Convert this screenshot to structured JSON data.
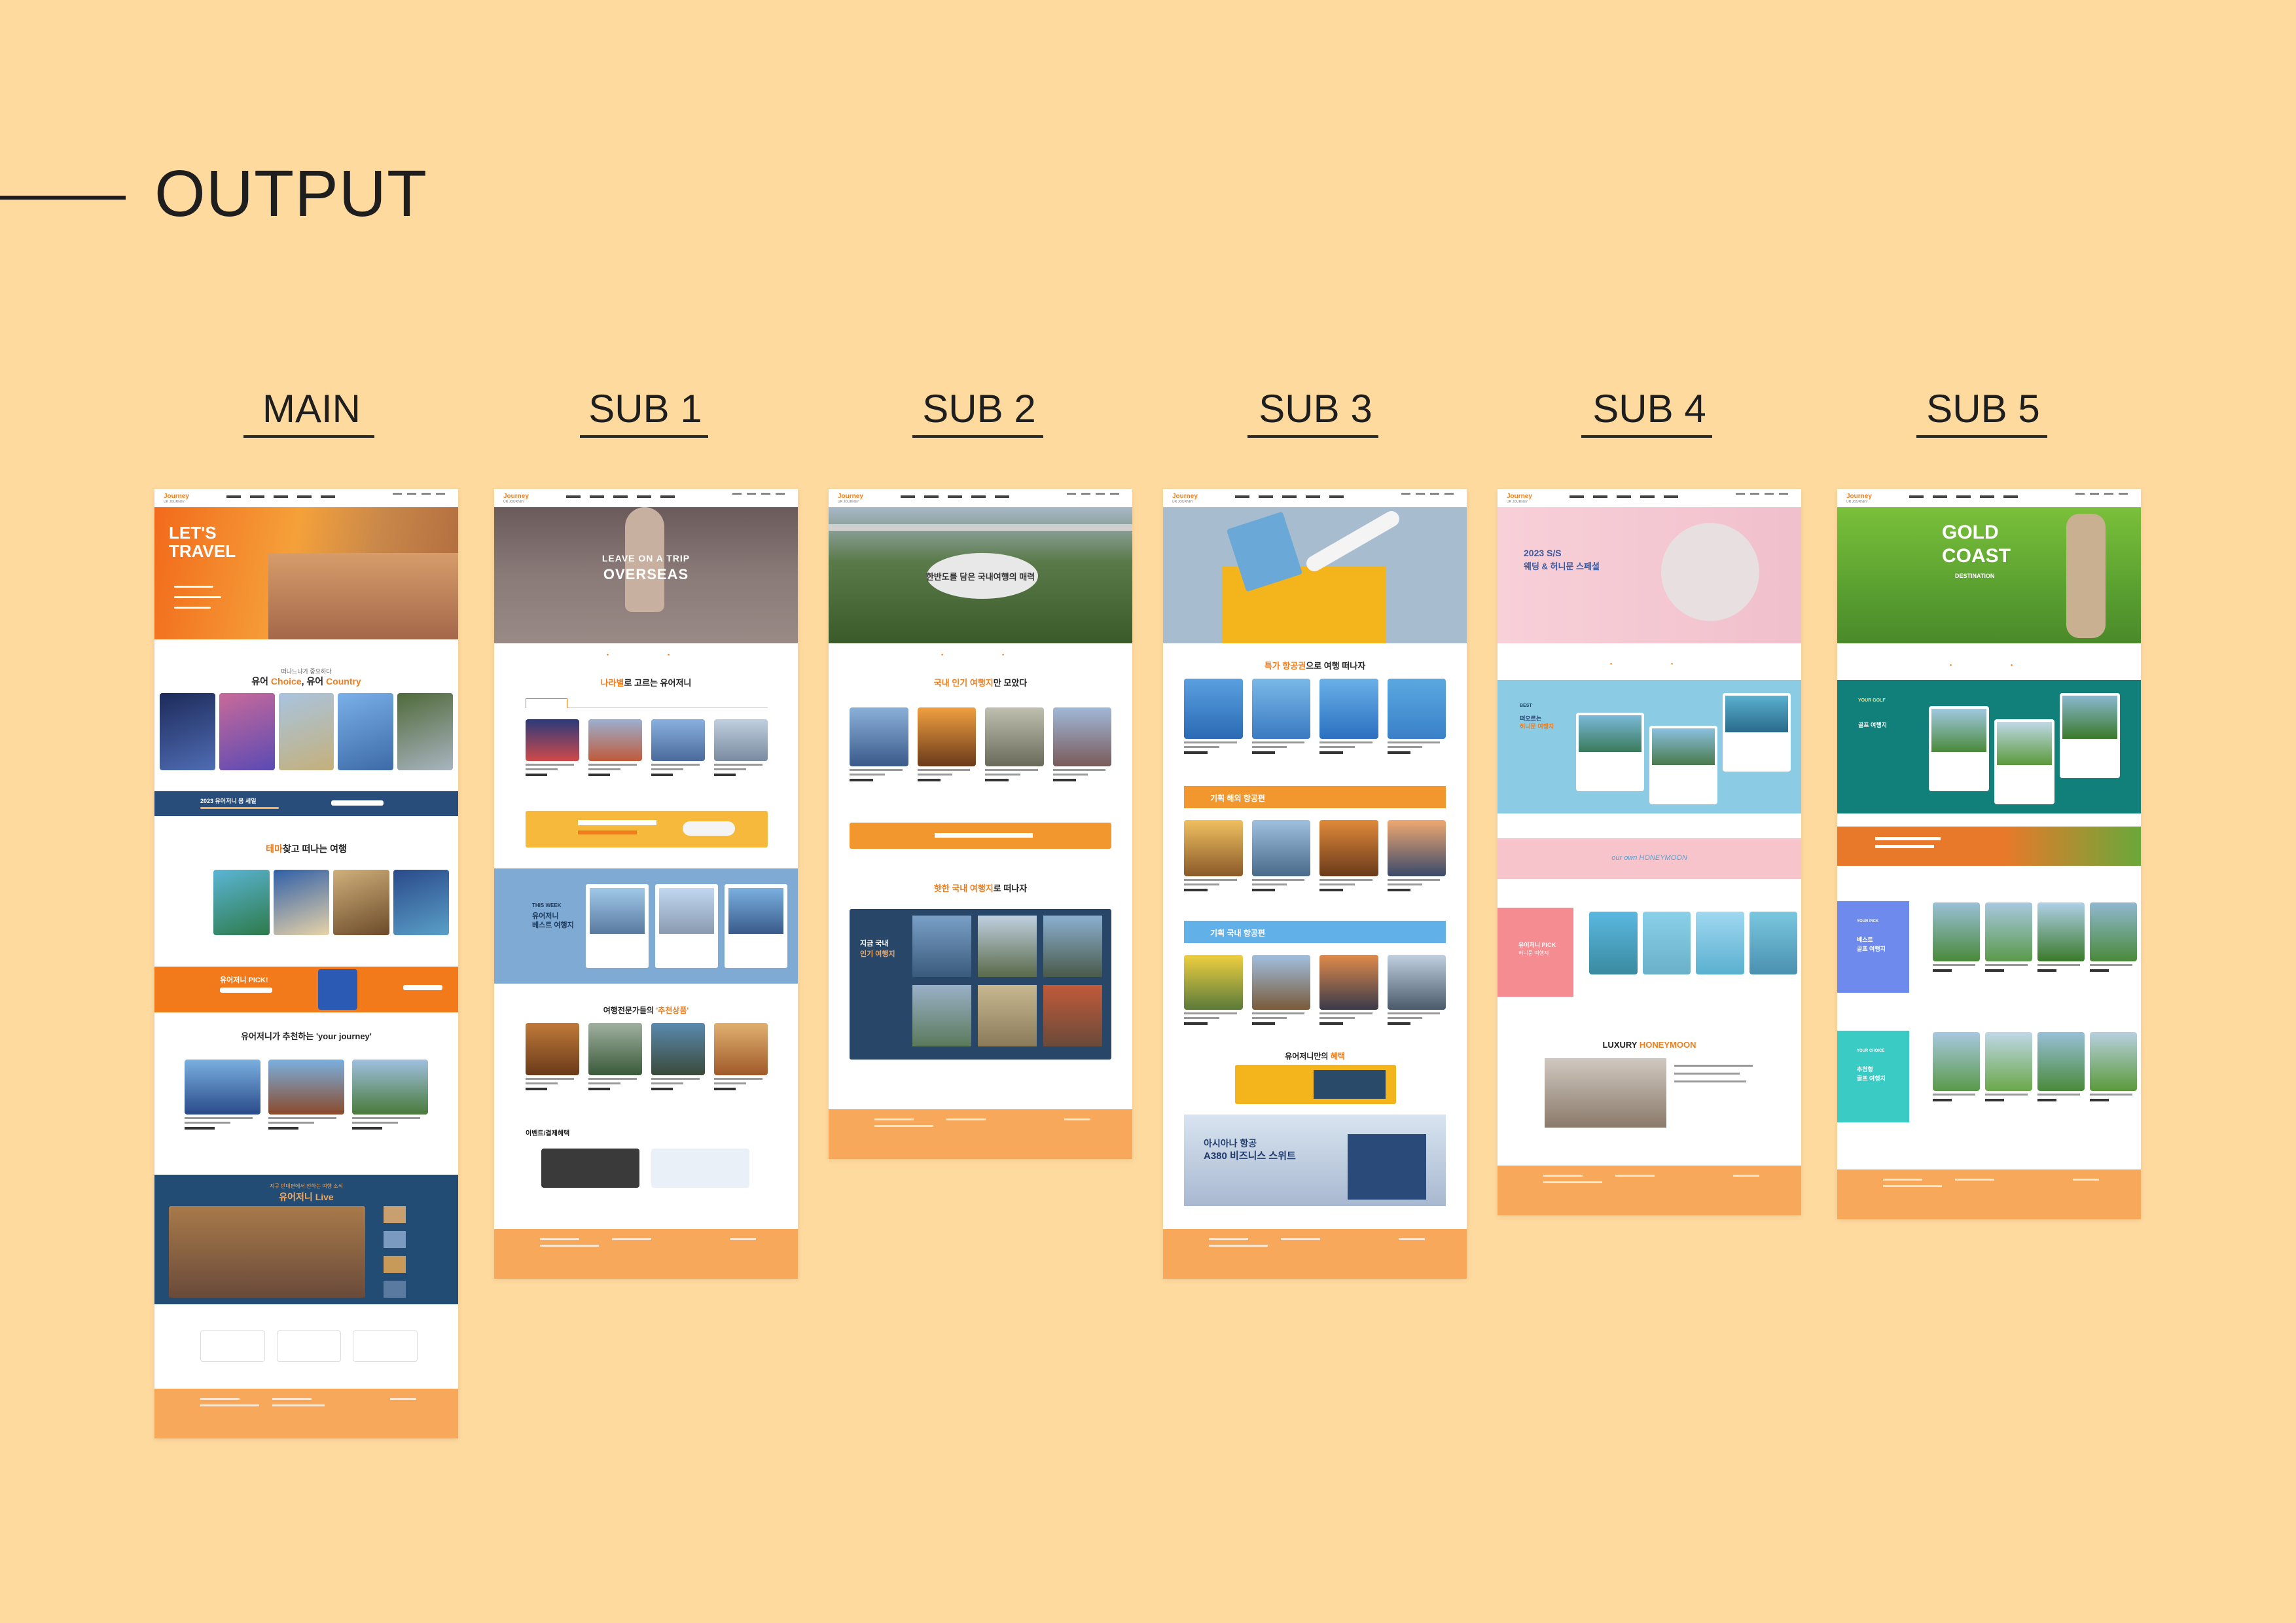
{
  "heading": {
    "title": "OUTPUT"
  },
  "columns": [
    {
      "label": "MAIN"
    },
    {
      "label": "SUB 1"
    },
    {
      "label": "SUB 2"
    },
    {
      "label": "SUB 3"
    },
    {
      "label": "SUB 4"
    },
    {
      "label": "SUB 5"
    }
  ],
  "main": {
    "hero_line1": "LET'S",
    "hero_line2": "TRAVEL",
    "sec1_kicker": "떠나느냐가 중요하다",
    "sec1_title_a": "유어 ",
    "sec1_title_b": "Choice",
    "sec1_title_c": ", 유어 ",
    "sec1_title_d": "Country",
    "sale_banner": "2023 유어저니 봄 세일",
    "sec2_title_a": "테마",
    "sec2_title_b": "찾고 떠나는 여행",
    "pick": "유어저니 PICK!",
    "sec3_title": "유어저니가 추천하는 'your journey'",
    "live_kicker": "지구 반대편에서 전하는 여행 소식",
    "live_title": "유어저니 Live"
  },
  "sub1": {
    "hero_line1": "LEAVE ON A TRIP",
    "hero_line2": "OVERSEAS",
    "sec_title_a": "나라별",
    "sec_title_b": "로 고르는 유어저니",
    "week_a": "THIS WEEK",
    "week_b": "유어저니",
    "week_c": "베스트 여행지",
    "sec2_title_a": "여행전문가들의 ",
    "sec2_title_b": "'추천상품'",
    "events": "이벤트/결제혜택"
  },
  "sub2": {
    "hero": "한반도를 담은 국내여행의 매력",
    "sec_title_a": "국내 인기 여행지",
    "sec_title_b": "만 모았다",
    "sec2_title_a": "핫한 국내 여행지",
    "sec2_title_b": "로 떠나자",
    "box_a": "지금 국내",
    "box_b": "인기 여행지"
  },
  "sub3": {
    "sec_title_a": "특가 항공권",
    "sec_title_b": "으로 여행 떠나자",
    "bar1": "기획 해외 항공편",
    "bar2": "기획 국내 항공편",
    "sec2_title_a": "유어저니만의 ",
    "sec2_title_b": "혜택",
    "ad_a": "아시아나 항공",
    "ad_b": "A380 비즈니스 스위트"
  },
  "sub4": {
    "hero_a": "2023 S/S",
    "hero_b": "웨딩 & 허니문 스페셜",
    "best_a": "BEST",
    "best_b": "떠오르는",
    "best_c": "허니문 여행지",
    "mid": "our own HONEYMOON",
    "pick_a": "유어저니 PICK",
    "pick_b": "허니문 여행지",
    "luxury_a": "LUXURY ",
    "luxury_b": "HONEYMOON"
  },
  "sub5": {
    "hero_a": "GOLD",
    "hero_b": "COAST",
    "hero_c": "DESTINATION",
    "card1_a": "YOUR GOLF",
    "card1_b": "골프 여행지",
    "pick_a": "YOUR PICK",
    "pick_b": "베스트",
    "pick_c": "골프 여행지",
    "choice_a": "YOUR CHOICE",
    "choice_b": "추천형",
    "choice_c": "골프 여행지"
  }
}
